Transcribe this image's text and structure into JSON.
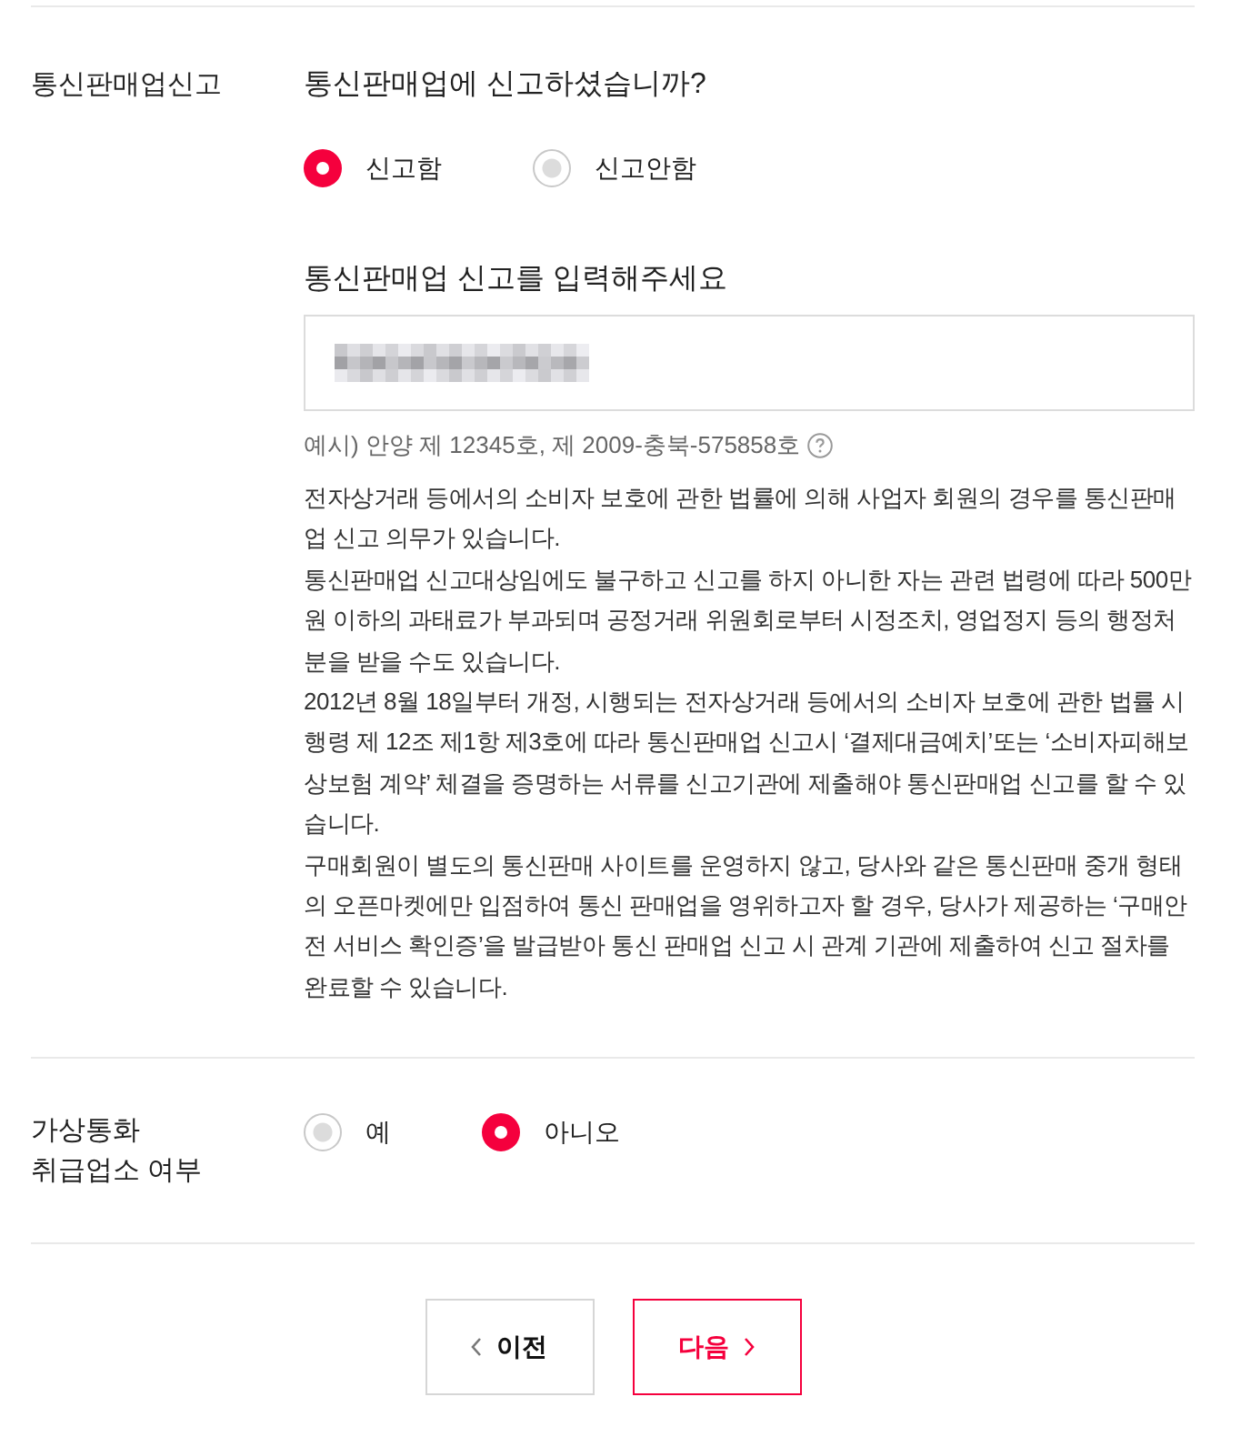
{
  "sections": [
    {
      "label": "통신판매업신고",
      "question": "통신판매업에 신고하셨습니까?",
      "options": [
        {
          "label": "신고함",
          "selected": true
        },
        {
          "label": "신고안함",
          "selected": false
        }
      ],
      "input_heading": "통신판매업 신고를 입력해주세요",
      "input": {
        "value_obscured": true
      },
      "example": "예시) 안양 제 12345호, 제 2009-충북-575858호",
      "notice": [
        "전자상거래 등에서의 소비자 보호에 관한 법률에 의해 사업자 회원의 경우를 통신판매업 신고 의무가 있습니다.",
        "통신판매업 신고대상임에도 불구하고 신고를 하지 아니한 자는 관련 법령에 따라 500만원 이하의 과태료가 부과되며 공정거래 위원회로부터 시정조치, 영업정지 등의 행정처분을 받을 수도 있습니다.",
        "2012년 8월 18일부터 개정, 시행되는 전자상거래 등에서의 소비자 보호에 관한 법률 시행령 제 12조 제1항 제3호에 따라 통신판매업 신고시 ‘결제대금예치’또는 ‘소비자피해보상보험 계약’ 체결을 증명하는 서류를 신고기관에 제출해야 통신판매업 신고를 할 수 있습니다.",
        "구매회원이 별도의 통신판매 사이트를 운영하지 않고, 당사와 같은 통신판매 중개 형태의 오픈마켓에만 입점하여 통신 판매업을 영위하고자 할 경우, 당사가 제공하는 ‘구매안전 서비스 확인증’을 발급받아 통신 판매업 신고 시 관계 기관에 제출하여 신고 절차를 완료할 수 있습니다."
      ]
    },
    {
      "label": "가상통화 취급업소 여부",
      "options": [
        {
          "label": "예",
          "selected": false
        },
        {
          "label": "아니오",
          "selected": true
        }
      ]
    }
  ],
  "buttons": [
    {
      "kind": "prev",
      "label": "이전"
    },
    {
      "kind": "next",
      "label": "다음"
    }
  ]
}
